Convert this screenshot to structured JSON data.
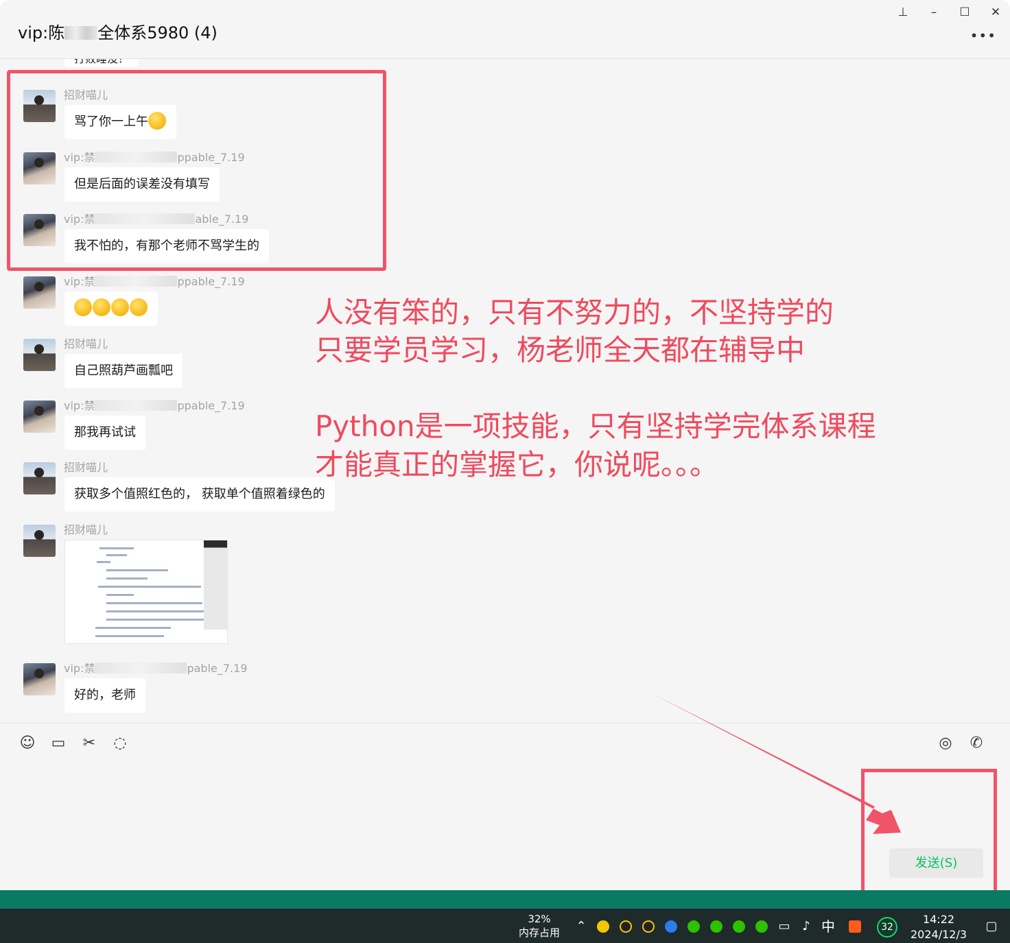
{
  "window": {
    "title_prefix": "vip:陈",
    "title_suffix": "全体系5980 (4)",
    "controls": {
      "pin": "pin-icon",
      "minimize": "minimize-icon",
      "maximize": "maximize-icon",
      "close": "close-icon",
      "more": "more-icon"
    }
  },
  "chat": {
    "cut_message": "打败睡没？",
    "messages": [
      {
        "sender": "招财喵儿",
        "text": "骂了你一上午"
      },
      {
        "sender_prefix": "vip:禁",
        "sender_suffix": "ppable_7.19",
        "text": "但是后面的误差没有填写"
      },
      {
        "sender_prefix": "vip:禁",
        "sender_suffix": "able_7.19",
        "text": "我不怕的，有那个老师不骂学生的"
      },
      {
        "sender_prefix": "vip:禁",
        "sender_suffix": "ppable_7.19",
        "text": ""
      },
      {
        "sender": "招财喵儿",
        "text": "自己照葫芦画瓢吧"
      },
      {
        "sender_prefix": "vip:禁",
        "sender_suffix": "ppable_7.19",
        "text": "那我再试试"
      },
      {
        "sender": "招财喵儿",
        "text": "获取多个值照红色的， 获取单个值照着绿色的"
      },
      {
        "sender": "招财喵儿",
        "text": ""
      },
      {
        "sender_prefix": "vip:禁",
        "sender_suffix": "pable_7.19",
        "text": "好的，老师"
      }
    ]
  },
  "annotation": {
    "lines": [
      "人没有笨的，只有不努力的，不坚持学的",
      "只要学员学习，杨老师全天都在辅导中",
      "Python是一项技能，只有坚持学完体系课程",
      "才能真正的掌握它，你说呢。。。"
    ],
    "color": "#ef4a5d"
  },
  "input": {
    "toolbar": [
      "emoji-icon",
      "folder-icon",
      "scissors-icon",
      "chat-bubble-icon"
    ],
    "right_tools": [
      "video-icon",
      "phone-icon"
    ],
    "send_label": "发送(S)",
    "send_color": "#07c160"
  },
  "taskbar": {
    "memory_percent": "32%",
    "memory_label": "内存占用",
    "ime": "中",
    "badge": "32",
    "time": "14:22",
    "date": "2024/12/3"
  }
}
